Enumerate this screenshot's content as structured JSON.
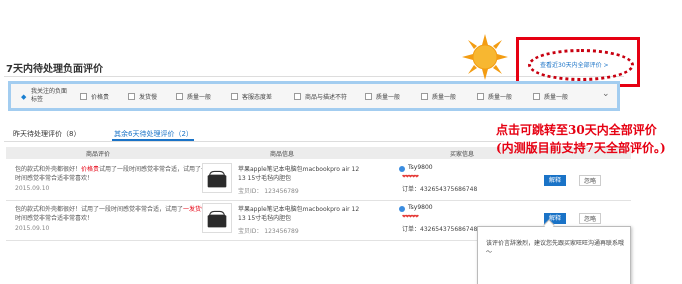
{
  "header": {
    "title": "7天内待处理负面评价",
    "view_all_link": "查看近30天内全部评价 >"
  },
  "filters": {
    "concern_label": "我关注的负面标签",
    "concern_icon": "tag-icon",
    "items": [
      {
        "label": "价格贵",
        "checked": false
      },
      {
        "label": "发货慢",
        "checked": false
      },
      {
        "label": "质量一般",
        "checked": false
      },
      {
        "label": "客服态度差",
        "checked": false
      },
      {
        "label": "商品与描述不符",
        "checked": false
      },
      {
        "label": "质量一般",
        "checked": false
      },
      {
        "label": "质量一般",
        "checked": false
      },
      {
        "label": "质量一般",
        "checked": false
      },
      {
        "label": "质量一般",
        "checked": false
      }
    ]
  },
  "tabs": {
    "today": "昨天待处理评价（8）",
    "other": "其余6天待处理评价（2）"
  },
  "table": {
    "headers": [
      "商品评价",
      "商品信息",
      "买家信息"
    ],
    "rows": [
      {
        "review_pre": "包的款式和外壳都很好！",
        "review_hl": "价格贵",
        "review_post": "试用了一段时间感觉非常合适，试用了一段时间感觉非常合适非常喜欢！",
        "date": "2015.09.10",
        "product": "苹果apple笔记本电脑包macbookpro air 12 13 15寸毛毡内胆包",
        "product_id": "宝贝ID： 123456789",
        "buyer": "Tsy9800",
        "hearts": "❤❤❤❤❤",
        "order": "订单：432654375686748",
        "explain": "解释",
        "ignore": "忽略"
      },
      {
        "review_pre": "包的款式和外壳都很好！试用了一段时间感觉非常合适，试用了",
        "review_hl": "一发货慢",
        "review_post": "段时间感觉非常合适非常喜欢！",
        "date": "2015.09.10",
        "product": "苹果apple笔记本电脑包macbookpro air 12 13 15寸毛毡内胆包",
        "product_id": "宝贝ID： 123456789",
        "buyer": "Tsy9800",
        "hearts": "❤❤❤❤❤",
        "order": "订单：432654375686748",
        "explain": "解释",
        "ignore": "忽略"
      }
    ]
  },
  "popup": {
    "text": "该评价言辞激烈，建议您先跟买家旺旺沟通再联系哦～"
  },
  "annotation": {
    "text": "点击可跳转至30天内全部评价(内测版目前支持7天全部评价。)"
  },
  "colors": {
    "accent": "#1a73c7",
    "highlight_red": "#e60012",
    "filter_border": "#a3cdf0"
  }
}
